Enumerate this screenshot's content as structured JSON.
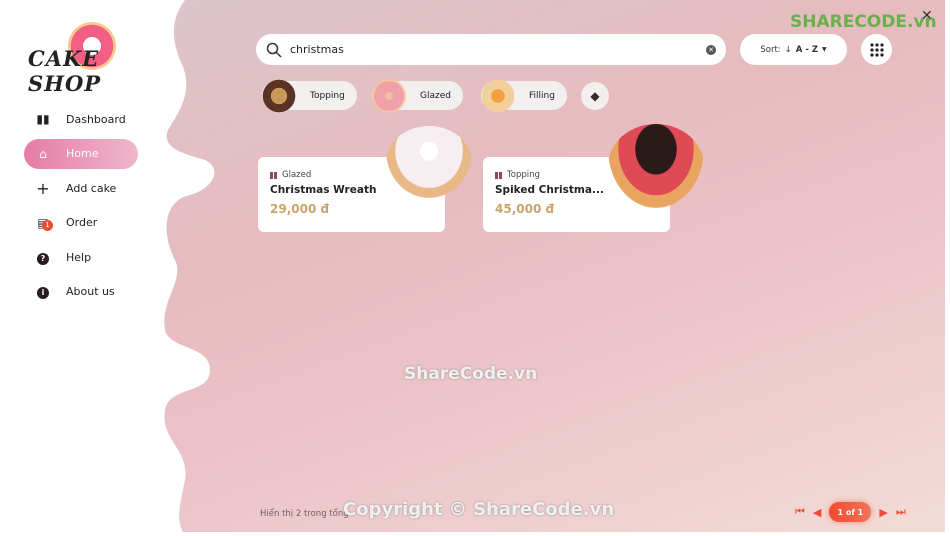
{
  "app": {
    "logo_text": "CAKE SHOP"
  },
  "sidebar": {
    "items": [
      {
        "label": "Dashboard",
        "icon": "bar-chart-icon",
        "active": false
      },
      {
        "label": "Home",
        "icon": "home-icon",
        "active": true
      },
      {
        "label": "Add cake",
        "icon": "plus-icon",
        "active": false
      },
      {
        "label": "Order",
        "icon": "clipboard-icon",
        "active": false,
        "badge": "1"
      },
      {
        "label": "Help",
        "icon": "help-icon",
        "active": false
      },
      {
        "label": "About us",
        "icon": "info-icon",
        "active": false
      }
    ]
  },
  "search": {
    "value": "christmas",
    "placeholder": ""
  },
  "sort": {
    "label": "Sort:",
    "arrow": "↓",
    "value": "A - Z"
  },
  "filters": [
    {
      "label": "Topping"
    },
    {
      "label": "Glazed"
    },
    {
      "label": "Filling"
    }
  ],
  "products": [
    {
      "category": "Glazed",
      "name": "Christmas Wreath",
      "price": "29,000 đ"
    },
    {
      "category": "Topping",
      "name": "Spiked Christma...",
      "price": "45,000 đ"
    }
  ],
  "footer": {
    "summary": "Hiển thị 2 trong tổng",
    "page": "1 of 1"
  },
  "watermarks": {
    "top": "SHARECODE.vn",
    "center": "ShareCode.vn",
    "copyright": "Copyright © ShareCode.vn"
  },
  "colors": {
    "accent": "#e67ca6",
    "price": "#c9a46a",
    "pager": "#ee4a3a"
  }
}
